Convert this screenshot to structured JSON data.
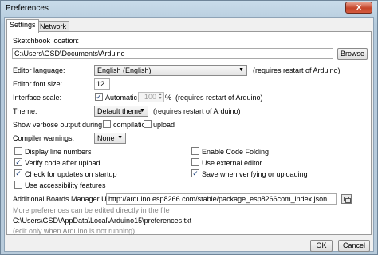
{
  "window": {
    "title": "Preferences",
    "close_glyph": "x"
  },
  "tabs": [
    {
      "label": "Settings"
    },
    {
      "label": "Network"
    }
  ],
  "settings": {
    "sketchbook_label": "Sketchbook location:",
    "sketchbook_value": "C:\\Users\\GSD\\Documents\\Arduino",
    "browse_label": "Browse",
    "editor_language_label": "Editor language:",
    "editor_language_value": "English (English)",
    "editor_language_note": "(requires restart of Arduino)",
    "font_size_label": "Editor font size:",
    "font_size_value": "12",
    "interface_scale_label": "Interface scale:",
    "automatic_label": "Automatic",
    "automatic_checked": true,
    "scale_value": "100",
    "scale_unit": "%",
    "scale_note": "(requires restart of Arduino)",
    "theme_label": "Theme:",
    "theme_value": "Default theme",
    "theme_note": "(requires restart of Arduino)",
    "verbose_label": "Show verbose output during:",
    "compilation_label": "compilation",
    "upload_label": "upload",
    "warnings_label": "Compiler warnings:",
    "warnings_value": "None",
    "options_left": [
      {
        "label": "Display line numbers",
        "checked": false
      },
      {
        "label": "Verify code after upload",
        "checked": true
      },
      {
        "label": "Check for updates on startup",
        "checked": true
      },
      {
        "label": "Use accessibility features",
        "checked": false
      }
    ],
    "options_right": [
      {
        "label": "Enable Code Folding",
        "checked": false
      },
      {
        "label": "Use external editor",
        "checked": false
      },
      {
        "label": "Save when verifying or uploading",
        "checked": true
      }
    ],
    "boards_url_label": "Additional Boards Manager URLs:",
    "boards_url_value": "http://arduino.esp8266.com/stable/package_esp8266com_index.json",
    "more_prefs_note": "More preferences can be edited directly in the file",
    "prefs_path": "C:\\Users\\GSD\\AppData\\Local\\Arduino15\\preferences.txt",
    "edit_note": "(edit only when Arduino is not running)"
  },
  "footer": {
    "ok_label": "OK",
    "cancel_label": "Cancel"
  },
  "icons": {
    "check": "✓",
    "dropdown": "▼",
    "spin_up": "▲",
    "spin_down": "▼"
  }
}
